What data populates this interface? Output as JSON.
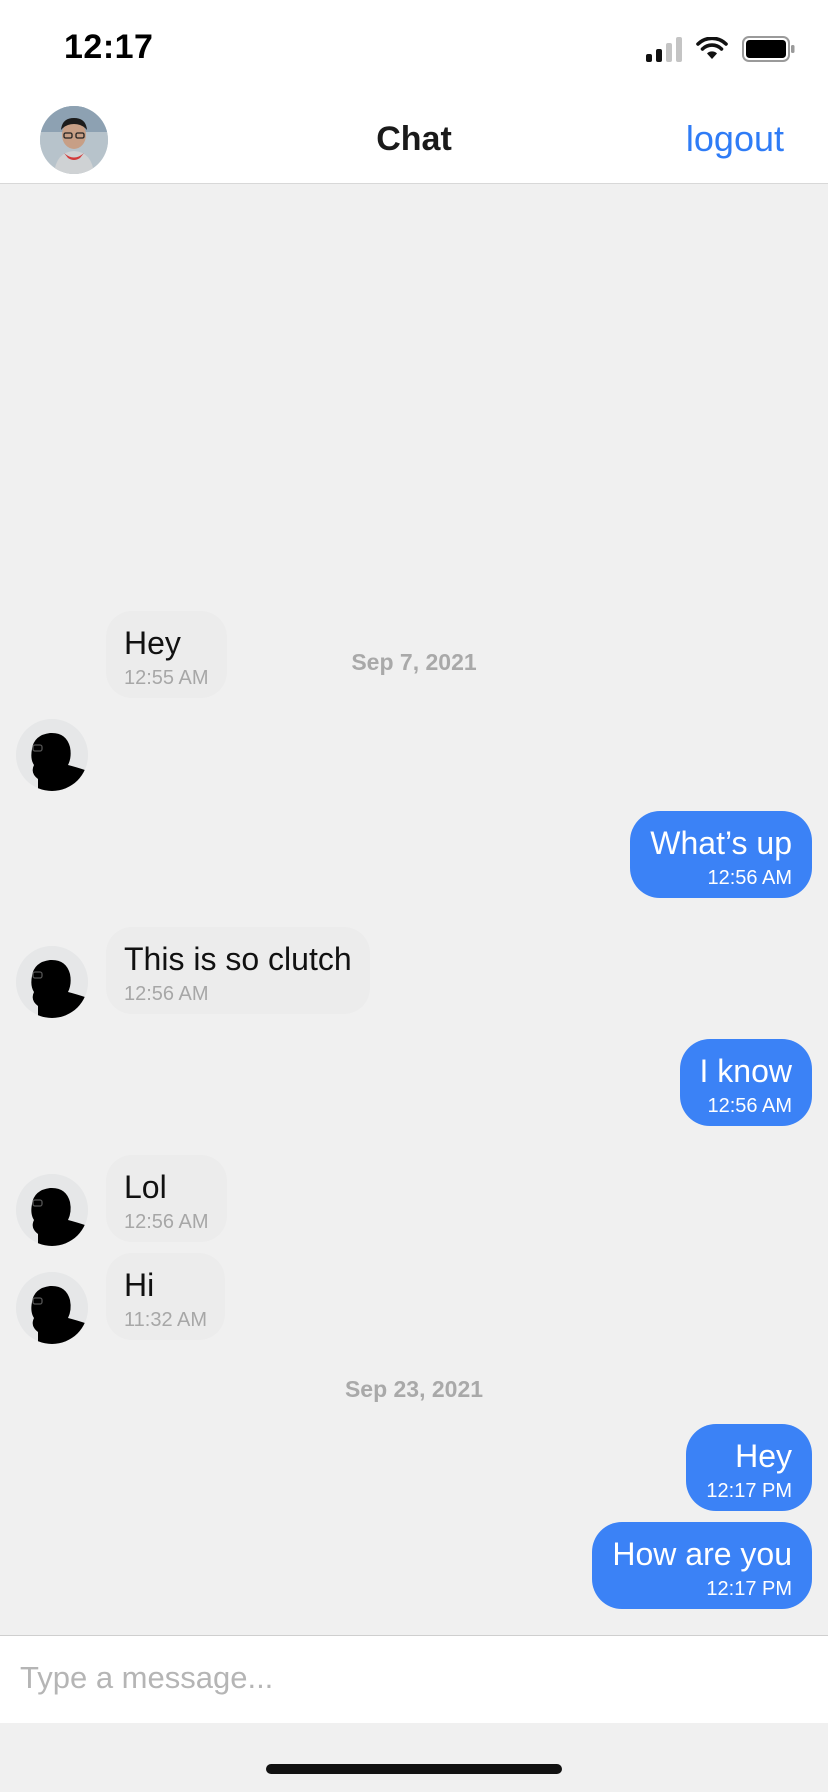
{
  "status_bar": {
    "time": "12:17"
  },
  "header": {
    "title": "Chat",
    "logout_label": "logout"
  },
  "messages": {
    "date_1": "Sep 7, 2021",
    "date_2": "Sep 23, 2021",
    "items": [
      {
        "direction": "incoming",
        "text": "Hey",
        "time": "12:55 AM"
      },
      {
        "direction": "outgoing",
        "text": "What’s up",
        "time": "12:56 AM"
      },
      {
        "direction": "incoming",
        "text": "This is so clutch",
        "time": "12:56 AM"
      },
      {
        "direction": "outgoing",
        "text": "I know",
        "time": "12:56 AM"
      },
      {
        "direction": "incoming",
        "text": "Lol",
        "time": "12:56 AM"
      },
      {
        "direction": "incoming",
        "text": "Hi",
        "time": "11:32 AM"
      },
      {
        "direction": "outgoing",
        "text": "Hey",
        "time": "12:17 PM"
      },
      {
        "direction": "outgoing",
        "text": "How are you",
        "time": "12:17 PM"
      }
    ]
  },
  "composer": {
    "placeholder": "Type a message..."
  },
  "colors": {
    "accent": "#3b82f6",
    "link": "#2f7cf6",
    "incoming_bubble": "#ececec"
  },
  "icons": {
    "signal": "cellular-signal-icon",
    "wifi": "wifi-icon",
    "battery": "battery-icon"
  }
}
